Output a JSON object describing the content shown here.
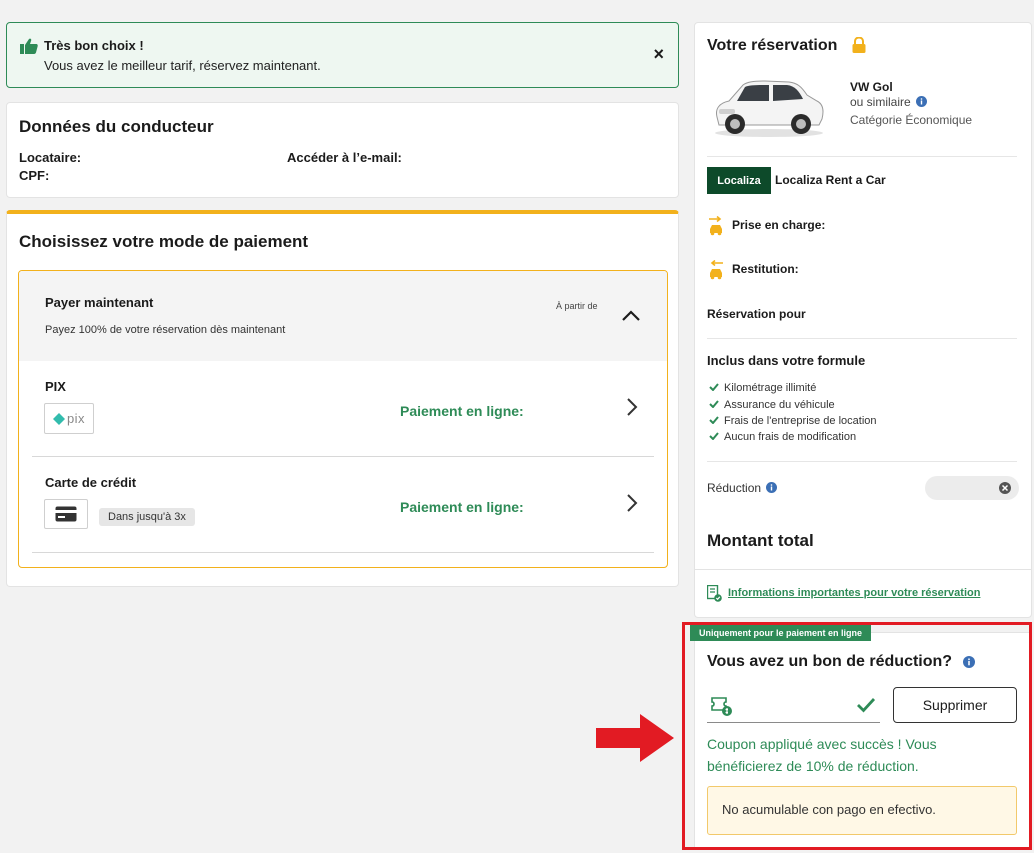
{
  "alert": {
    "title": "Très bon choix !",
    "message": "Vous avez le meilleur tarif, réservez maintenant.",
    "close_symbol": "×",
    "icon": "thumbs-up-icon"
  },
  "driver": {
    "title": "Données du conducteur",
    "renter_label": "Locataire:",
    "cpf_label": "CPF:",
    "email_label": "Accéder à l’e-mail:"
  },
  "payment": {
    "title": "Choisissez votre mode de paiement",
    "option": {
      "title": "Payer maintenant",
      "subtitle": "Payez 100% de votre réservation dès maintenant",
      "from_label": "À partir de"
    },
    "methods": [
      {
        "title": "PIX",
        "logo_text": "pix",
        "online_label": "Paiement en ligne:"
      },
      {
        "title": "Carte de crédit",
        "tag": "Dans jusqu'à 3x",
        "online_label": "Paiement en ligne:"
      }
    ]
  },
  "reservation": {
    "title": "Votre réservation",
    "car_model": "VW Gol",
    "car_similar": "ou similaire",
    "car_category": "Catégorie Économique",
    "company_logo": "Localiza",
    "company_name": "Localiza Rent a Car",
    "pickup_label": "Prise en charge:",
    "return_label": "Restitution:",
    "booking_for_label": "Réservation pour",
    "included_title": "Inclus dans votre formule",
    "included": [
      "Kilométrage illimité",
      "Assurance du véhicule",
      "Frais de l'entreprise de location",
      "Aucun frais de modification"
    ],
    "discount_label": "Réduction",
    "total_label": "Montant total",
    "info_link": "Informations importantes pour votre réservation"
  },
  "coupon": {
    "tag": "Uniquement pour le paiement en ligne",
    "title": "Vous avez un bon de réduction?",
    "remove_label": "Supprimer",
    "success": "Coupon appliqué avec succès ! Vous bénéficierez de 10% de réduction.",
    "warning": "No acumulable con pago en efectivo."
  },
  "colors": {
    "green": "#2e8b57",
    "yellow": "#f2b11c",
    "red": "#e21b23"
  }
}
